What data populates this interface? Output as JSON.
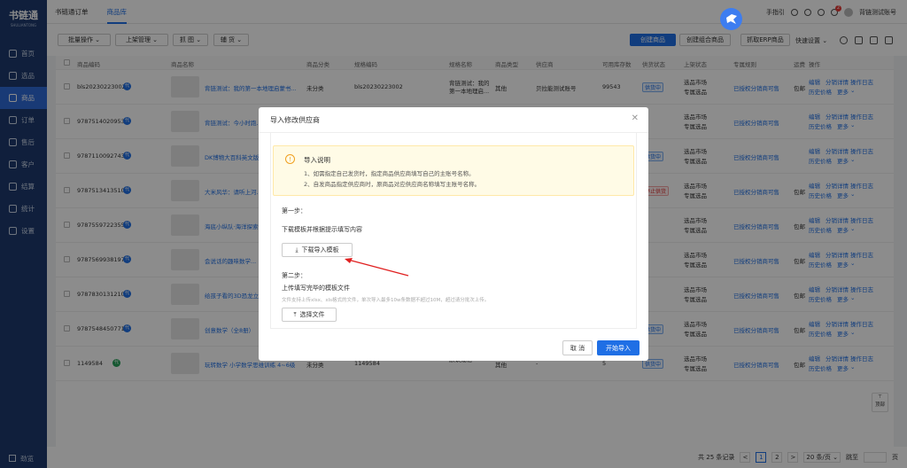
{
  "app": {
    "logo": "书链通",
    "logo_sub": "SHULIANTONG"
  },
  "sidebar": {
    "items": [
      {
        "label": "首页",
        "icon": "home-icon"
      },
      {
        "label": "选品",
        "icon": "select-icon"
      },
      {
        "label": "商品",
        "icon": "goods-icon",
        "active": true
      },
      {
        "label": "订单",
        "icon": "order-icon"
      },
      {
        "label": "售后",
        "icon": "aftersale-icon"
      },
      {
        "label": "客户",
        "icon": "customer-icon"
      },
      {
        "label": "结算",
        "icon": "settle-icon"
      },
      {
        "label": "统计",
        "icon": "stats-icon"
      },
      {
        "label": "设置",
        "icon": "settings-icon"
      }
    ],
    "footer": "劲览"
  },
  "topbar": {
    "tabs": [
      "书链通订单",
      "商品库"
    ],
    "active_tab": "商品库",
    "help": "手指引",
    "notif_count": "2",
    "user": "背链测试账号"
  },
  "toolbar": {
    "batch": "批量操作",
    "shelf": "上架管理",
    "grab": "抓 图",
    "edit": "辅 货",
    "create": "创建商品",
    "create_combo": "创建组合商品",
    "fetch_erp": "抓取ERP商品",
    "quick_settings": "快速设置"
  },
  "table": {
    "headers": [
      "商品编码",
      "商品名称",
      "商品分类",
      "规格编码",
      "规格名称",
      "商品类型",
      "供应商",
      "可用库存数",
      "供货状态",
      "上架状态",
      "专属规则",
      "运费",
      "操作"
    ],
    "rows": [
      {
        "code": "bls20230223002",
        "name": "背链测试：我的第一本地理启蒙书...",
        "category": "未分类",
        "spec_code": "bls20230223002",
        "spec_name": "背链测试：我的第一本地理启...",
        "type": "其他",
        "supplier": "贝拉能测试账号",
        "stock": "99543",
        "status": "供货中",
        "shelf1": "选品市场",
        "shelf2": "专属选品",
        "rule": "已授权分销商可售",
        "freight": "包邮",
        "op1": "编辑",
        "op2": "分销详情",
        "op3": "操作日志",
        "op4": "历史价格",
        "op5": "更多"
      },
      {
        "code": "9787514020953",
        "name": "背链测试：今小时跑...",
        "category": "",
        "spec_code": "",
        "spec_name": "",
        "type": "",
        "supplier": "",
        "stock": "",
        "status": "",
        "shelf1": "选品市场",
        "shelf2": "专属选品",
        "rule": "已授权分销商可售",
        "freight": "",
        "op1": "编辑",
        "op2": "分销详情",
        "op3": "操作日志",
        "op4": "历史价格",
        "op5": "更多"
      },
      {
        "code": "9787110092743",
        "name": "DK博物大百科英文版...",
        "category": "",
        "spec_code": "",
        "spec_name": "",
        "type": "",
        "supplier": "",
        "stock": "",
        "status": "供货中",
        "shelf1": "选品市场",
        "shelf2": "专属选品",
        "rule": "已授权分销商可售",
        "freight": "",
        "op1": "编辑",
        "op2": "分销详情",
        "op3": "操作日志",
        "op4": "历史价格",
        "op5": "更多"
      },
      {
        "code": "9787513413510",
        "name": "大米风华：请听上河...",
        "category": "",
        "spec_code": "",
        "spec_name": "",
        "type": "",
        "supplier": "",
        "stock": "",
        "status": "停止供货",
        "shelf1": "选品市场",
        "shelf2": "专属选品",
        "rule": "已授权分销商可售",
        "freight": "包邮",
        "op1": "编辑",
        "op2": "分销详情",
        "op3": "操作日志",
        "op4": "历史价格",
        "op5": "更多"
      },
      {
        "code": "9787559722355",
        "name": "海底小纵队·海洋探索...",
        "category": "",
        "spec_code": "",
        "spec_name": "",
        "type": "",
        "supplier": "",
        "stock": "",
        "status": "",
        "shelf1": "选品市场",
        "shelf2": "专属选品",
        "rule": "已授权分销商可售",
        "freight": "包邮",
        "op1": "编辑",
        "op2": "分销详情",
        "op3": "操作日志",
        "op4": "历史价格",
        "op5": "更多"
      },
      {
        "code": "9787569938197",
        "name": "会说话的趣味数学...",
        "category": "",
        "spec_code": "",
        "spec_name": "",
        "type": "",
        "supplier": "",
        "stock": "",
        "status": "",
        "shelf1": "选品市场",
        "shelf2": "专属选品",
        "rule": "已授权分销商可售",
        "freight": "包邮",
        "op1": "编辑",
        "op2": "分销详情",
        "op3": "操作日志",
        "op4": "历史价格",
        "op5": "更多"
      },
      {
        "code": "9787830131210",
        "name": "给孩子看的3D恐龙立...",
        "category": "",
        "spec_code": "",
        "spec_name": "",
        "type": "",
        "supplier": "",
        "stock": "",
        "status": "",
        "shelf1": "选品市场",
        "shelf2": "专属选品",
        "rule": "已授权分销商可售",
        "freight": "包邮",
        "op1": "编辑",
        "op2": "分销详情",
        "op3": "操作日志",
        "op4": "历史价格",
        "op5": "更多"
      },
      {
        "code": "9787548450771",
        "name": "创意数学（全8册）",
        "category": "未分类",
        "spec_code": "9787548450771",
        "spec_name": "默认规格",
        "type": "其他",
        "supplier": "虚拟供应商1",
        "stock": "1000",
        "status": "供货中",
        "shelf1": "选品市场",
        "shelf2": "专属选品",
        "rule": "已授权分销商可售",
        "freight": "包邮",
        "op1": "编辑",
        "op2": "分销详情",
        "op3": "操作日志",
        "op4": "历史价格",
        "op5": "更多"
      },
      {
        "code": "1149584",
        "name": "玩转数学 小学数学思维训练 4~6级",
        "category": "未分类",
        "spec_code": "1149584",
        "spec_name": "默认规格",
        "type": "其他",
        "supplier": "-",
        "stock": "5",
        "status": "供货中",
        "shelf1": "选品市场",
        "shelf2": "专属选品",
        "rule": "已授权分销商可售",
        "freight": "包邮",
        "op1": "编辑",
        "op2": "分销详情",
        "op3": "操作日志",
        "op4": "历史价格",
        "op5": "更多"
      }
    ]
  },
  "pager": {
    "total": "共 25 条记录",
    "page1": "1",
    "page2": "2",
    "next": ">",
    "size": "20 条/页",
    "goto": "跳至",
    "page_unit": "页"
  },
  "float_top": {
    "arrow": "⊤",
    "label": "顶部"
  },
  "modal": {
    "title": "导入修改供应商",
    "notice_title": "导入说明",
    "notice_lines": [
      "1、如需指定自己发货时，指定商品供应商填写自己的主账号名称。",
      "2、自发商品指定供应商时，原商品对应供应商名称填写主账号名称。"
    ],
    "step1_title": "第一步：",
    "step1_desc": "下载模板并根据提示填写内容",
    "download_btn": "下载导入模板",
    "step2_title": "第二步：",
    "step2_desc": "上传填写完毕的模板文件",
    "hint": "文件支持上传xlsx、xls格式的文件，单次导入最多10w条数据不超过10M，超过请分批次上传。",
    "choose_btn": "选择文件",
    "cancel": "取 消",
    "confirm": "开始导入"
  },
  "colors": {
    "primary": "#1f6fe5",
    "sidebar": "#1e3a6e",
    "arrow": "#e02020"
  }
}
